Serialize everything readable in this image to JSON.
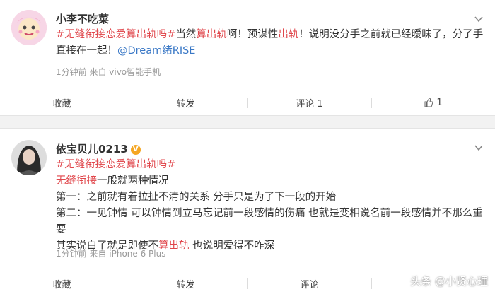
{
  "post1": {
    "username": "小李不吃菜",
    "segments": {
      "hashtag": "#无缝衔接恋爱算出轨吗#",
      "t1": "当然",
      "r1": "算出轨",
      "t2": "啊！预谋性",
      "r2": "出轨",
      "t3": "！说明没分手之前就已经暧昧了，分了手直接在一起！",
      "mention": "@Dream绪RISE"
    },
    "meta": "1分钟前 来自 vivo智能手机",
    "actions": {
      "collect": "收藏",
      "repost": "转发",
      "comment": "评论 1",
      "like": "1"
    }
  },
  "post2": {
    "username": "依宝贝儿0213",
    "verified_icon": "V",
    "hashtag": "#无缝衔接恋爱算出轨吗#",
    "line2": {
      "red": "无缝衔接",
      "rest": "一般就两种情况"
    },
    "line3": "第一：之前就有着拉扯不清的关系 分手只是为了下一段的开始",
    "line4": "第二：一见钟情 可以钟情到立马忘记前一段感情的伤痛 也就是变相说名前一段感情并不那么重要",
    "line5": {
      "a": "其实说白了就是即使不",
      "red": "算出轨",
      "b": " 也说明爱得不咋深"
    },
    "meta": "1分钟前 来自 iPhone 6 Plus",
    "actions": {
      "collect": "收藏",
      "repost": "转发",
      "comment": "评论"
    }
  },
  "watermark": "头条 @小贤心理",
  "colors": {
    "accent_red": "#e0464b",
    "mention_blue": "#3a78c6",
    "meta_gray": "#999999"
  }
}
